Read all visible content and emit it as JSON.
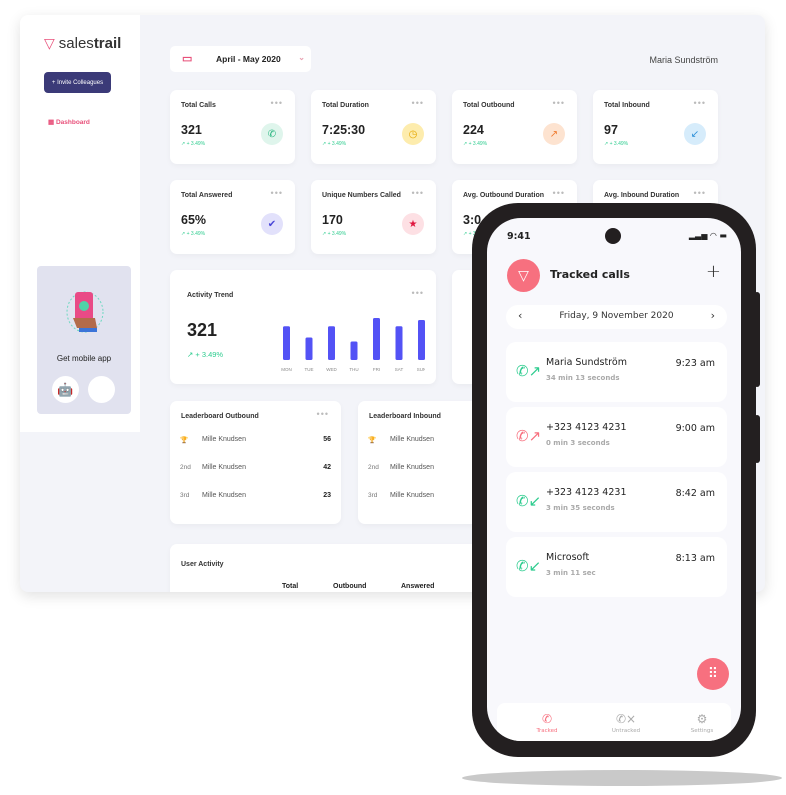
{
  "brand": {
    "name_light": "sales",
    "name_bold": "trail",
    "accent": "#e8507a"
  },
  "sidebar": {
    "invite_label": "Invite Colleagues",
    "dashboard_label": "Dashboard",
    "app_card": {
      "title": "Get mobile app"
    }
  },
  "header": {
    "date_range": "April - May 2020",
    "user": "Maria Sundström"
  },
  "stats": [
    {
      "label": "Total Calls",
      "value": "321",
      "change": "+ 3.49%",
      "icon": "phone-icon",
      "color": "#dff5ec",
      "fg": "#21b37b"
    },
    {
      "label": "Total Duration",
      "value": "7:25:30",
      "change": "+ 3.49%",
      "icon": "clock-icon",
      "color": "#fdecad",
      "fg": "#e6a700"
    },
    {
      "label": "Total Outbound",
      "value": "224",
      "change": "+ 3.49%",
      "icon": "outbound-call-icon",
      "color": "#fde3d0",
      "fg": "#f07a2e"
    },
    {
      "label": "Total Inbound",
      "value": "97",
      "change": "+ 3.49%",
      "icon": "inbound-call-icon",
      "color": "#d6ecfb",
      "fg": "#2b8fd8"
    },
    {
      "label": "Total Answered",
      "value": "65%",
      "change": "+ 3.49%",
      "icon": "check-icon",
      "color": "#e2e1fb",
      "fg": "#4b48d8"
    },
    {
      "label": "Unique Numbers Called",
      "value": "170",
      "change": "+ 3.49%",
      "icon": "star-icon",
      "color": "#fde0e4",
      "fg": "#e0173f"
    },
    {
      "label": "Avg. Outbound Duration",
      "value": "3:0",
      "change": "+ 3.49%"
    },
    {
      "label": "Avg. Inbound Duration"
    }
  ],
  "activity": {
    "title": "Activity Trend",
    "value": "321",
    "change": "+ 3.49%",
    "chart_data": {
      "type": "bar",
      "categories": [
        "MON",
        "TUE",
        "WED",
        "THU",
        "FRI",
        "SAT",
        "SUN"
      ],
      "values": [
        33,
        22,
        33,
        18,
        41,
        33,
        39
      ],
      "color": "#5352f5"
    }
  },
  "leaderboard_outbound": {
    "title": "Leaderboard Outbound",
    "rows": [
      {
        "rank": "trophy",
        "name": "Mille Knudsen",
        "score": "56"
      },
      {
        "rank": "2nd",
        "name": "Mille Knudsen",
        "score": "42"
      },
      {
        "rank": "3rd",
        "name": "Mille Knudsen",
        "score": "23"
      }
    ]
  },
  "leaderboard_inbound": {
    "title": "Leaderboard Inbound",
    "rows": [
      {
        "rank": "trophy",
        "name": "Mille Knudsen"
      },
      {
        "rank": "2nd",
        "name": "Mille Knudsen"
      },
      {
        "rank": "3rd",
        "name": "Mille Knudsen"
      }
    ]
  },
  "user_activity": {
    "title": "User Activity",
    "columns": [
      "Total",
      "Outbound",
      "Answered"
    ]
  },
  "phone": {
    "time": "9:41",
    "title": "Tracked calls",
    "date": "Friday, 9 November 2020",
    "calls": [
      {
        "name": "Maria Sundström",
        "duration": "34 min 13 seconds",
        "time": "9:23 am",
        "type": "outbound",
        "color": "#2ecc8f"
      },
      {
        "name": "+323 4123 4231",
        "duration": "0 min 3 seconds",
        "time": "9:00 am",
        "type": "outbound-missed",
        "color": "#f7707f"
      },
      {
        "name": "+323 4123 4231",
        "duration": "3 min 35 seconds",
        "time": "8:42 am",
        "type": "inbound",
        "color": "#2ecc8f"
      },
      {
        "name": "Microsoft",
        "duration": "3 min 11 sec",
        "time": "8:13 am",
        "type": "inbound",
        "color": "#2ecc8f"
      }
    ],
    "nav": [
      "Tracked",
      "Untracked",
      "Settings"
    ]
  }
}
